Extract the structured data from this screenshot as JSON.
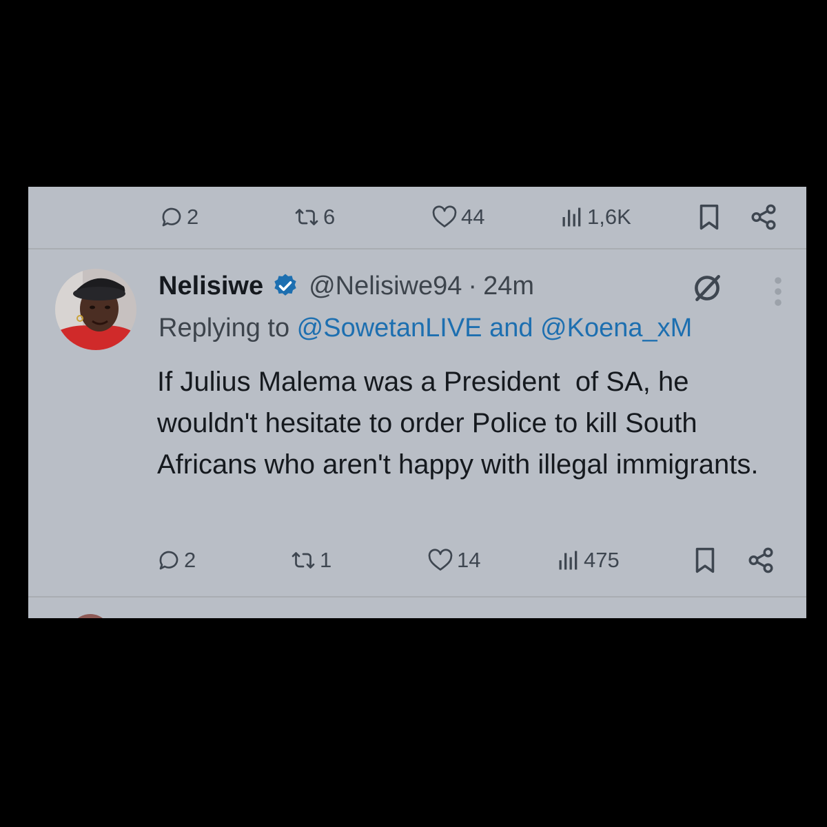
{
  "prev_tweet": {
    "actions": {
      "replies": "2",
      "reposts": "6",
      "likes": "44",
      "views": "1,6K"
    }
  },
  "tweet": {
    "author": {
      "name": "Nelisiwe",
      "handle": "@Nelisiwe94"
    },
    "separator": "·",
    "time": "24m",
    "replying": {
      "prefix": "Replying to ",
      "mention1": "@SowetanLIVE",
      "joiner": " and ",
      "mention2": "@Koena_xM"
    },
    "text": "If Julius Malema was a President  of SA, he wouldn't hesitate to order Police to kill South Africans who aren't happy with illegal immigrants.",
    "actions": {
      "replies": "2",
      "reposts": "1",
      "likes": "14",
      "views": "475"
    }
  },
  "icons": {
    "reply": "reply-icon",
    "repost": "repost-icon",
    "like": "heart-icon",
    "views": "views-icon",
    "bookmark": "bookmark-icon",
    "share": "share-icon",
    "verified": "verified-badge-icon",
    "grok": "grok-icon",
    "more": "more-vertical-icon"
  },
  "colors": {
    "card_background": "#b9bec6",
    "link": "#1d6fb0",
    "verified": "#1d6fb0",
    "text": "#15191e",
    "secondary_text": "#3d444c"
  }
}
